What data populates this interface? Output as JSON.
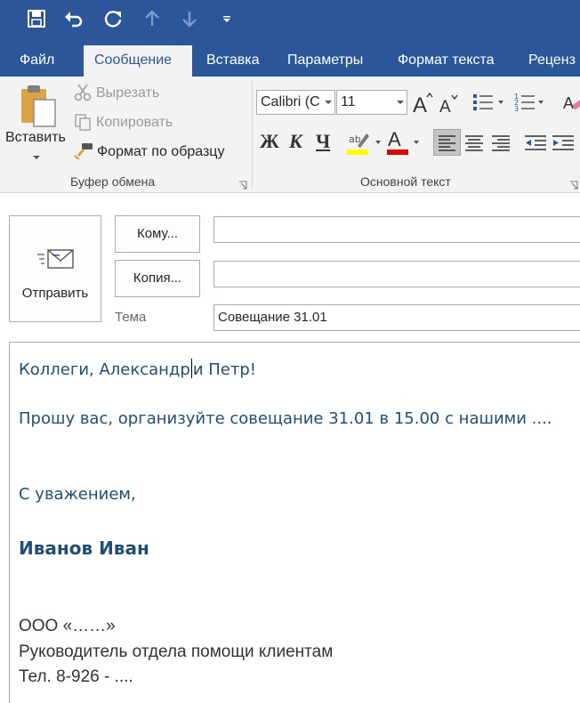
{
  "tabs": [
    "Файл",
    "Сообщение",
    "Вставка",
    "Параметры",
    "Формат текста",
    "Реценз"
  ],
  "active_tab": "Сообщение",
  "clipboard": {
    "paste": "Вставить",
    "cut": "Вырезать",
    "copy": "Копировать",
    "format_painter": "Формат по образцу",
    "group_label": "Буфер обмена"
  },
  "basic_text": {
    "font_name": "Calibri (C",
    "font_size": "11",
    "bold": "Ж",
    "italic": "К",
    "underline": "Ч",
    "group_label": "Основной текст",
    "highlight_color": "#ffff00",
    "font_color": "#e00000"
  },
  "message": {
    "send": "Отправить",
    "to_button": "Кому...",
    "cc_button": "Копия...",
    "to_value": "",
    "cc_value": "",
    "subject_label": "Тема",
    "subject_value": "Совещание 31.01"
  },
  "body": {
    "greeting_before_caret": "Коллеги, Александр",
    "greeting_after_caret": "и Петр!",
    "request": "Прошу вас, организуйте совещание 31.01 в 15.00 с нашими ....",
    "closing": "С уважением,",
    "signature_name": "Иванов Иван",
    "company": "ООО «……»",
    "position": "Руководитель отдела помощи клиентам",
    "phone": "Тел. 8-926 - ...."
  },
  "colors": {
    "accent": "#2b579a",
    "body_text": "#1f4e79"
  }
}
